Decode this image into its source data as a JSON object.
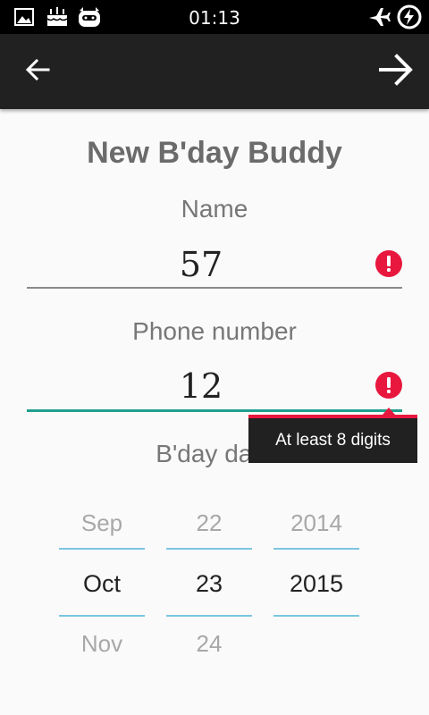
{
  "status_bar": {
    "time": "01:13",
    "icons": [
      "image-icon",
      "cake-icon",
      "cyanogen-icon",
      "airplane-icon",
      "battery-charging-icon"
    ]
  },
  "toolbar": {
    "back_icon": "arrow-left-icon",
    "next_icon": "arrow-right-icon"
  },
  "form": {
    "title": "New B'day Buddy",
    "name_label": "Name",
    "name_value": "57",
    "phone_label": "Phone number",
    "phone_value": "12",
    "phone_error": "At least 8 digits",
    "date_label": "B'day date"
  },
  "date_picker": {
    "month": {
      "prev": "Sep",
      "current": "Oct",
      "next": "Nov"
    },
    "day": {
      "prev": "22",
      "current": "23",
      "next": "24"
    },
    "year": {
      "prev": "2014",
      "current": "2015",
      "next": ""
    }
  },
  "colors": {
    "error": "#e8173e",
    "accent": "#1f9f8f",
    "picker_line": "#7ac6e0",
    "toolbar": "#212121"
  }
}
